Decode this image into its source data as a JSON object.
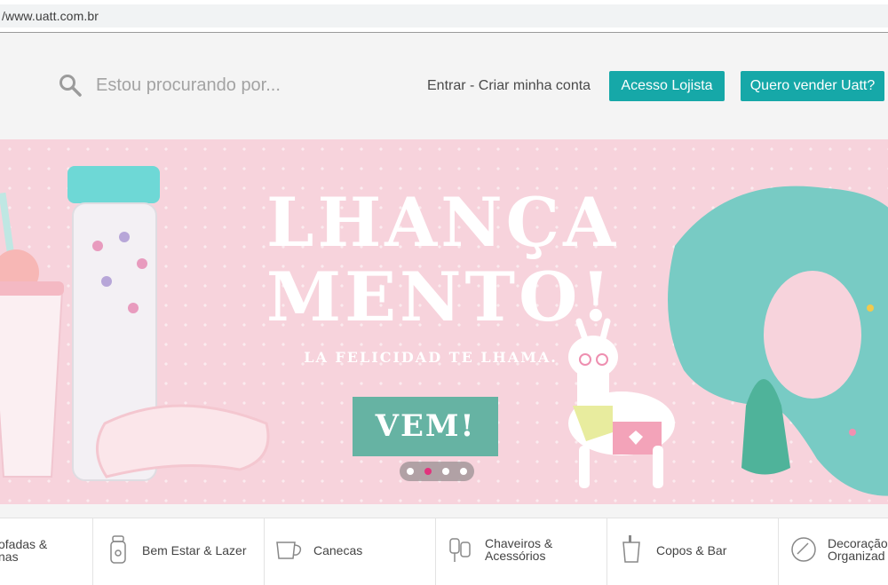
{
  "browser": {
    "url": "/www.uatt.com.br"
  },
  "header": {
    "search": {
      "placeholder": "Estou procurando por..."
    },
    "login_link": "Entrar - Criar minha conta",
    "buttons": {
      "lojista": "Acesso Lojista",
      "vender": "Quero vender Uatt?"
    },
    "accent_color": "#16a8a8"
  },
  "banner": {
    "headline_line1": "LHANÇA",
    "headline_line2": "MENTO!",
    "subtitle": "LA FELICIDAD TE LHAMA.",
    "cta": "VEM!",
    "background_color": "#f7d3dc",
    "cta_color": "#66b3a3",
    "carousel": {
      "total": 4,
      "active_index": 1,
      "active_color": "#e2337d"
    }
  },
  "categories": [
    {
      "label": "ofadas &\nnas",
      "icon": "pillow-icon"
    },
    {
      "label": "Bem Estar & Lazer",
      "icon": "bottle-icon"
    },
    {
      "label": "Canecas",
      "icon": "mug-icon"
    },
    {
      "label": "Chaveiros &\nAcessórios",
      "icon": "keychain-icon"
    },
    {
      "label": "Copos & Bar",
      "icon": "cup-icon"
    },
    {
      "label": "Decoração\nOrganizad",
      "icon": "mirror-icon"
    }
  ]
}
